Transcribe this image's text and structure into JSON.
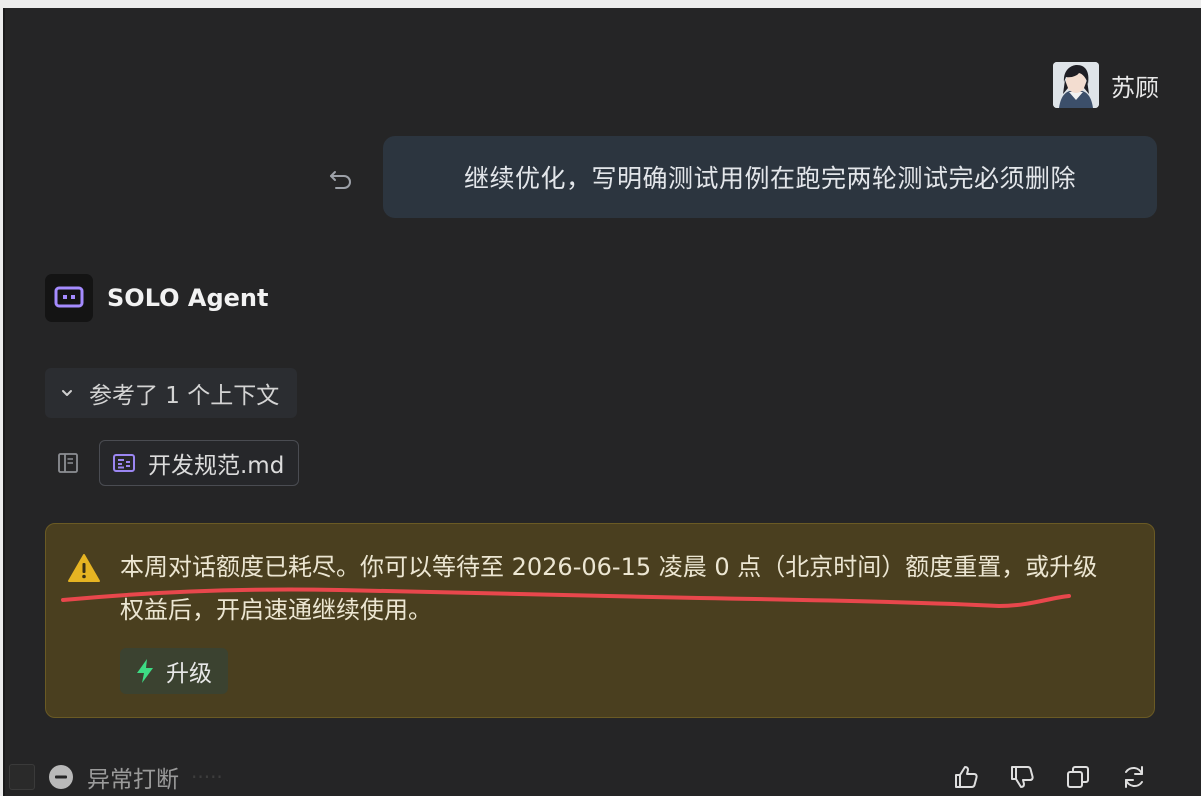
{
  "user": {
    "name": "苏顾",
    "avatar_icon": "avatar-anime-portrait"
  },
  "user_message": {
    "text": "继续优化，写明确测试用例在跑完两轮测试完必须删除",
    "undo_icon": "undo-icon"
  },
  "agent": {
    "name": "SOLO Agent",
    "logo_icon": "solo-agent-logo-icon",
    "accent": "#a58bff"
  },
  "context": {
    "toggle_label": "参考了 1 个上下文",
    "chevron_icon": "chevron-down-icon",
    "file_name": "开发规范.md",
    "panel_icon": "panel-icon",
    "file_icon": "markdown-file-icon"
  },
  "warning": {
    "text": "本周对话额度已耗尽。你可以等待至 2026-06-15 凌晨 0 点（北京时间）额度重置，或升级权益后，开启速通继续使用。",
    "icon": "warning-triangle-icon",
    "upgrade_label": "升级",
    "upgrade_icon": "lightning-icon",
    "bg_color": "#4a3f1f",
    "icon_color": "#e6b422",
    "annotation_color": "#e8474c"
  },
  "footer": {
    "status_text": "异常打断",
    "status_icon": "minus-circle-icon",
    "faded_text": "·····",
    "actions": [
      "thumbs-up-icon",
      "thumbs-down-icon",
      "copy-icon",
      "refresh-icon"
    ]
  }
}
